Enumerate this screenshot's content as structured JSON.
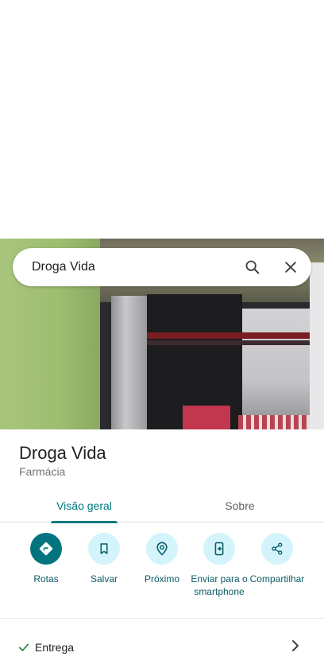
{
  "search": {
    "query": "Droga Vida"
  },
  "place": {
    "name": "Droga Vida",
    "category": "Farmácia"
  },
  "tabs": [
    {
      "label": "Visão geral",
      "active": true
    },
    {
      "label": "Sobre",
      "active": false
    }
  ],
  "actions": [
    {
      "label": "Rotas",
      "icon": "directions-icon"
    },
    {
      "label": "Salvar",
      "icon": "bookmark-icon"
    },
    {
      "label": "Próximo",
      "icon": "nearby-icon"
    },
    {
      "label": "Enviar para o smartphone",
      "icon": "send-to-phone-icon"
    },
    {
      "label": "Compartilhar",
      "icon": "share-icon"
    }
  ],
  "attributes": [
    {
      "label": "Entrega",
      "icon": "check-icon"
    }
  ],
  "colors": {
    "accent": "#00787f",
    "action_bg": "#d3f4fb",
    "primary_action_bg": "#00747e"
  }
}
